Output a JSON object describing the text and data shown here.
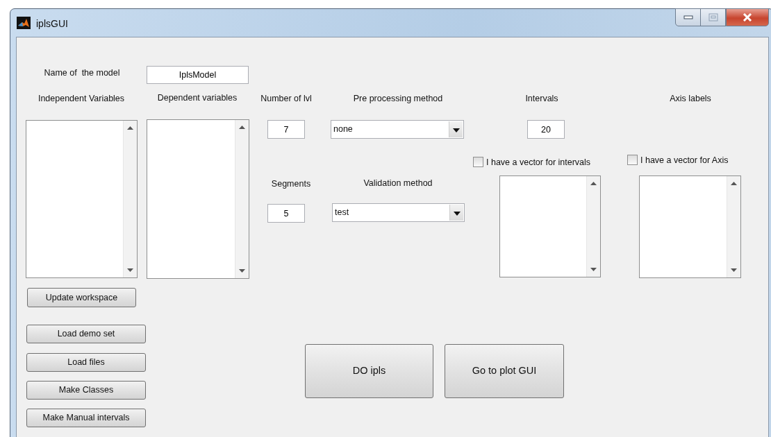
{
  "window": {
    "title": "iplsGUI"
  },
  "model_name": {
    "label": "Name of  the model",
    "value": "IplsModel"
  },
  "independent_variables": {
    "label": "Independent Variables"
  },
  "dependent_variables": {
    "label": "Dependent variables"
  },
  "number_of_lvl": {
    "label": "Number of lvl",
    "value": "7"
  },
  "preprocessing": {
    "label": "Pre processing method",
    "value": "none"
  },
  "intervals": {
    "label": "Intervals",
    "value": "20"
  },
  "axis_labels": {
    "label": "Axis labels"
  },
  "interval_vector": {
    "label": "I have a vector for intervals",
    "checked": false
  },
  "axis_vector": {
    "label": "I have a vector for Axis",
    "checked": false
  },
  "segments": {
    "label": "Segments",
    "value": "5"
  },
  "validation": {
    "label": "Validation method",
    "value": "test"
  },
  "update_button": "Update workspace",
  "side_buttons": [
    "Load demo set",
    "Load files",
    "Make Classes",
    "Make Manual intervals"
  ],
  "main_buttons": [
    "DO ipls",
    "Go to plot GUI"
  ]
}
